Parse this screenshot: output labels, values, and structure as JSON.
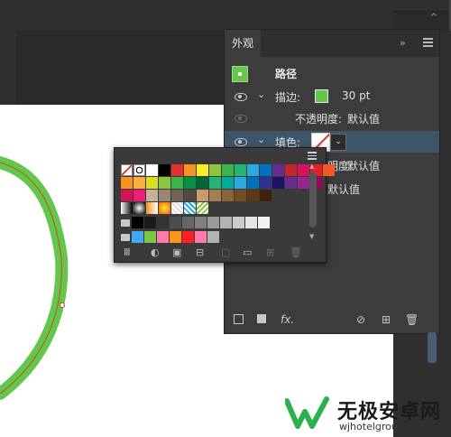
{
  "panel": {
    "tab": "外观",
    "collapse_icon": "»",
    "menu_icon": "hamburger-menu-icon",
    "path_label": "路径",
    "stroke": {
      "label": "描边:",
      "color": "#62c74a",
      "weight": "30 pt"
    },
    "opacity": {
      "label": "不透明度:",
      "value": "默认值"
    },
    "fill": {
      "label": "填色:",
      "value": "none"
    },
    "fill_opacity": {
      "label": "明度:",
      "value": "默认值"
    },
    "overall_opacity": {
      "value": "默认值"
    }
  },
  "swatches": {
    "row1": [
      "none",
      "registration",
      "#ffffff",
      "#000000",
      "#e8302a",
      "#f7931e",
      "#fcee21",
      "#8cc63f",
      "#39b54a",
      "#22b573",
      "#29abe2",
      "#0071bc",
      "#662d91",
      "#c1272d",
      "#d4145a",
      "#ed1c24",
      "#f15a24"
    ],
    "row2": [
      "#f7931e",
      "#fbb03b",
      "#d9e021",
      "#8cc63f",
      "#39b54a",
      "#009245",
      "#006837",
      "#22b573",
      "#00a99d",
      "#29abe2",
      "#0071bc",
      "#2e3192",
      "#1b1464",
      "#662d91",
      "#93278f",
      "#9e005d"
    ],
    "row3": [
      "#d4145a",
      "#ed1e79",
      "#c7b299",
      "#998675",
      "#736357",
      "#534741",
      "#c69c6d",
      "#a67c52",
      "#8c6239",
      "#754c24",
      "#603813",
      "#42210b"
    ],
    "row5": [
      "folder",
      "#000000",
      "#1a1a1a",
      "#333333",
      "#4d4d4d",
      "#666666",
      "#808080",
      "#999999",
      "#b3b3b3",
      "#cccccc",
      "#e6e6e6",
      "#f2f2f2"
    ],
    "row6": [
      "folder",
      "#3fa9f5",
      "#7ac943",
      "#ff7bac",
      "#ff931e",
      "#ff1d25",
      "#ff7bac",
      "#b3b3b3"
    ]
  },
  "watermark": {
    "title": "无极安卓网",
    "url": "wjhotelgroup.com"
  }
}
